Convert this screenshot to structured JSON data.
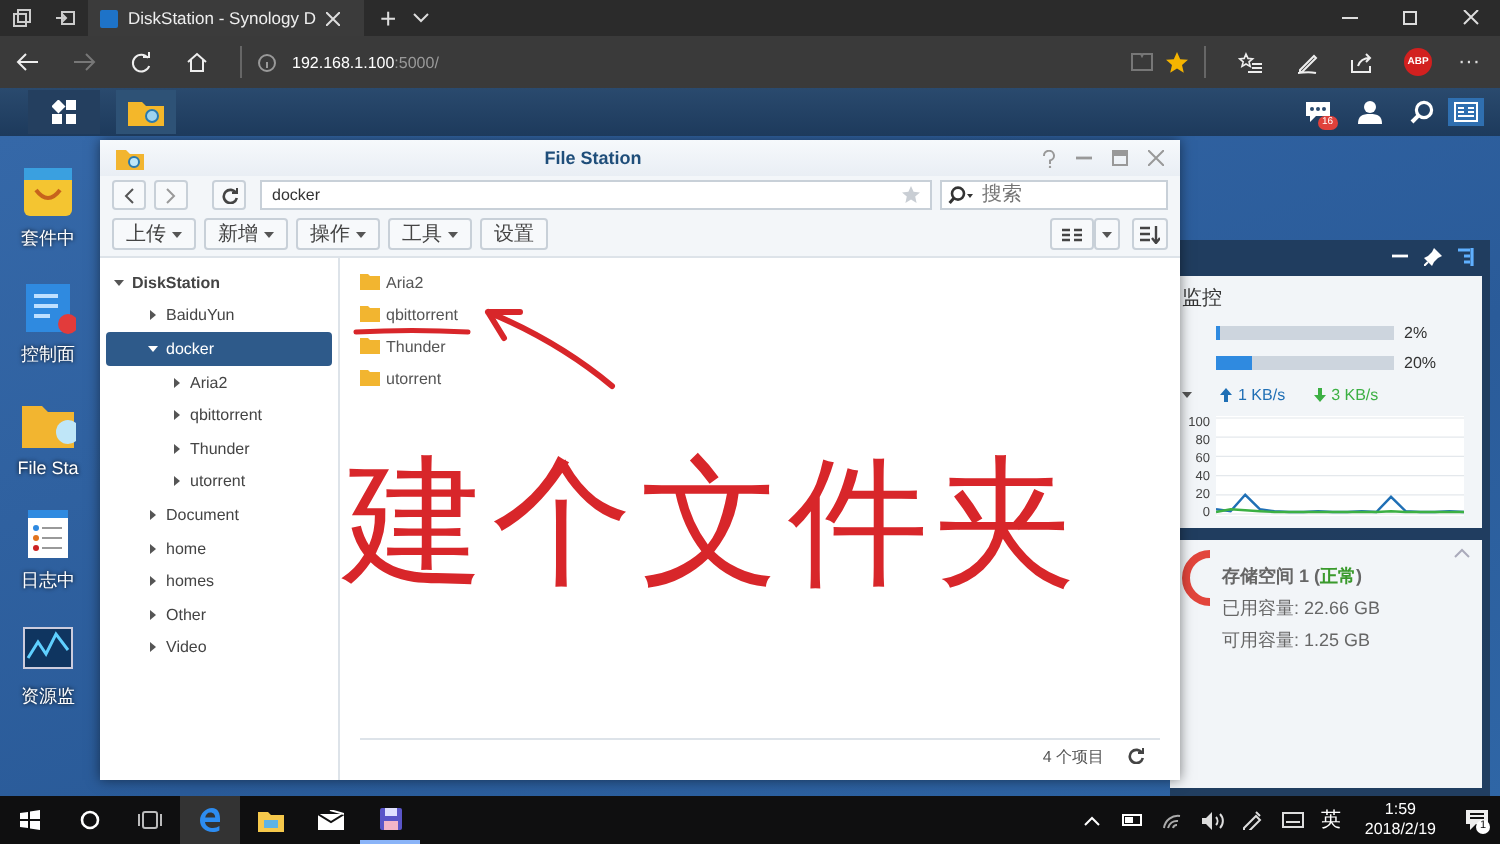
{
  "browser": {
    "tabs": [
      {
        "title": "DiskStation - Synology D",
        "selected": true
      }
    ],
    "new_tab": "+",
    "address": {
      "host": "192.168.1.100",
      "port": ":5000/"
    },
    "favorite": true,
    "extension_badge": "ABP",
    "more": "···"
  },
  "dsm_bar": {
    "notification_count": "16"
  },
  "desktop": {
    "icons": [
      {
        "kind": "package",
        "label": "套件中"
      },
      {
        "kind": "control",
        "label": "控制面"
      },
      {
        "kind": "folder",
        "label": "File Sta"
      },
      {
        "kind": "log",
        "label": "日志中"
      },
      {
        "kind": "monitor",
        "label": "资源监"
      }
    ]
  },
  "file_station": {
    "title": "File Station",
    "path": "docker",
    "search": {
      "placeholder": "搜索"
    },
    "toolbar": [
      {
        "label": "上传",
        "dropdown": true
      },
      {
        "label": "新增",
        "dropdown": true
      },
      {
        "label": "操作",
        "dropdown": true
      },
      {
        "label": "工具",
        "dropdown": true
      },
      {
        "label": "设置",
        "dropdown": false
      }
    ],
    "tree": [
      {
        "label": "DiskStation",
        "expanded": true,
        "selected": false,
        "children": [
          {
            "label": "BaiduYun",
            "expanded": false,
            "selected": false
          },
          {
            "label": "docker",
            "expanded": true,
            "selected": true,
            "children": [
              {
                "label": "Aria2",
                "expanded": false,
                "selected": false
              },
              {
                "label": "qbittorrent",
                "expanded": false,
                "selected": false
              },
              {
                "label": "Thunder",
                "expanded": false,
                "selected": false
              },
              {
                "label": "utorrent",
                "expanded": false,
                "selected": false
              }
            ]
          },
          {
            "label": "Document",
            "expanded": false,
            "selected": false
          },
          {
            "label": "home",
            "expanded": false,
            "selected": false
          },
          {
            "label": "homes",
            "expanded": false,
            "selected": false
          },
          {
            "label": "Other",
            "expanded": false,
            "selected": false
          },
          {
            "label": "Video",
            "expanded": false,
            "selected": false
          }
        ]
      }
    ],
    "files": [
      "Aria2",
      "qbittorrent",
      "Thunder",
      "utorrent"
    ],
    "status": "4 个项目"
  },
  "annotation": {
    "text": "建个文件夹"
  },
  "widget": {
    "monitor": {
      "title": "监控",
      "meters": [
        {
          "level": 0.02,
          "reading": "2%"
        },
        {
          "level": 0.2,
          "reading": "20%"
        }
      ],
      "upload": "1 KB/s",
      "download": "3 KB/s",
      "chart_data": {
        "type": "line",
        "ylim": [
          0,
          100
        ],
        "yticks": [
          0,
          20,
          40,
          60,
          80,
          100
        ],
        "grid": true,
        "series": [
          {
            "color": "#1f6fb5",
            "values": [
              5,
              3,
              20,
              5,
              3,
              2,
              2,
              3,
              2,
              2,
              3,
              2,
              18,
              3,
              2,
              2,
              3,
              2
            ]
          },
          {
            "color": "#3cb043",
            "values": [
              2,
              5,
              4,
              3,
              2,
              2,
              2,
              2,
              2,
              2,
              2,
              2,
              3,
              2,
              2,
              2,
              2,
              2
            ]
          }
        ]
      }
    },
    "storage": {
      "title": "存储空间 1 (**正常**)",
      "used": "已用容量: 22.66 GB",
      "free": "可用容量: 1.25 GB"
    }
  },
  "taskbar": {
    "ime": "英",
    "time": "1:59",
    "date": "2018/2/19",
    "notifications": "1"
  }
}
